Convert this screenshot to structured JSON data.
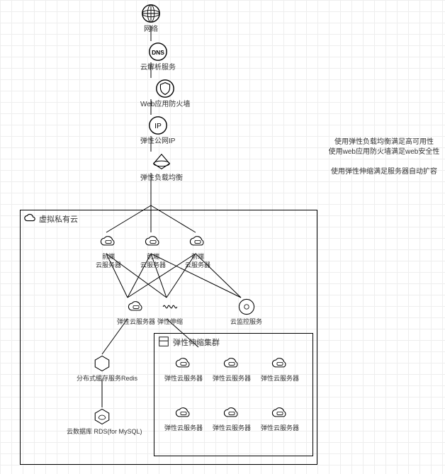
{
  "nodes": {
    "network": {
      "label": "网络"
    },
    "dns": {
      "label": "云解析服务"
    },
    "waf": {
      "label": "Web应用防火墙"
    },
    "eip": {
      "label": "弹性公网IP"
    },
    "elb": {
      "label": "弹性负载均衡"
    },
    "vpc": {
      "title": "虚拟私有云"
    },
    "fe1": {
      "label": "前端\n云服务器"
    },
    "fe2": {
      "label": "前端\n云服务器"
    },
    "fe3": {
      "label": "前端\n云服务器"
    },
    "ecs": {
      "label": "弹性云服务器"
    },
    "as": {
      "label": "弹性伸缩"
    },
    "monitor": {
      "label": "云监控服务"
    },
    "redis": {
      "label": "分布式缓存服务Redis"
    },
    "rds": {
      "label": "云数据库 RDS(for MySQL)"
    },
    "asg": {
      "title": "弹性伸缩集群"
    },
    "asg_servers": {
      "label": "弹性云服务器"
    }
  },
  "annotations": {
    "note1": "使用弹性负载均衡满足高可用性",
    "note2": "使用web应用防火墙满足web安全性",
    "note3": "使用弹性伸缩满足服务器自动扩容"
  }
}
